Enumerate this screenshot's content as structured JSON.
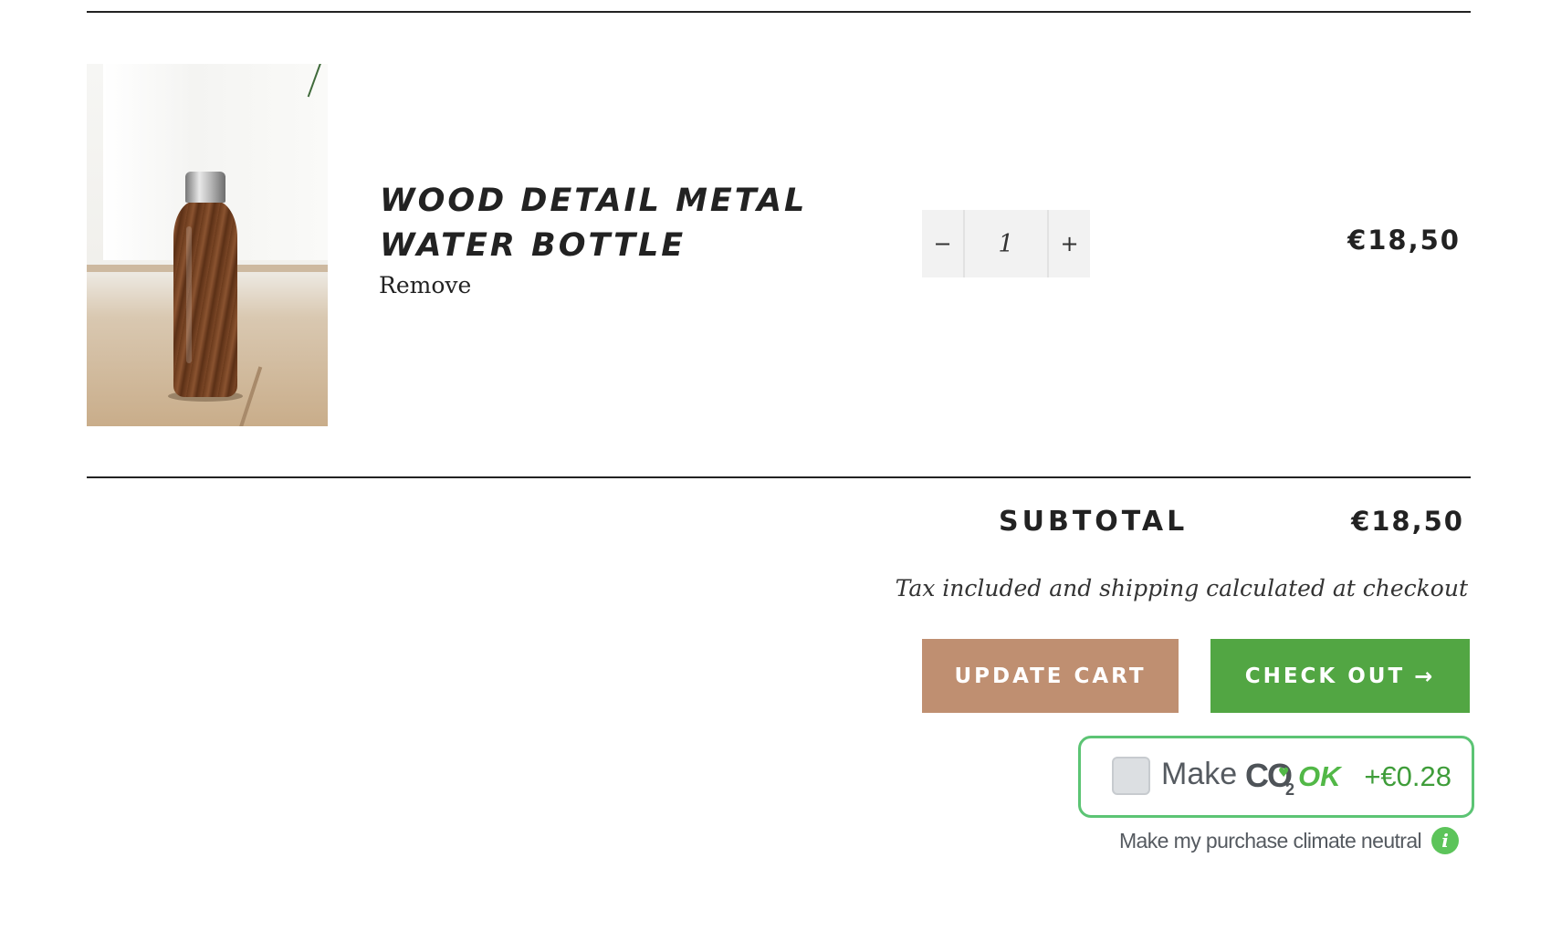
{
  "cart_item": {
    "title": "WOOD DETAIL METAL WATER BOTTLE",
    "remove_label": "Remove",
    "quantity": "1",
    "decrease_label": "−",
    "increase_label": "+",
    "line_price": "€18,50",
    "image_icon": "water-bottle-photo"
  },
  "totals": {
    "subtotal_label": "SUBTOTAL",
    "subtotal_value": "€18,50",
    "tax_note": "Tax included and shipping calculated at checkout"
  },
  "actions": {
    "update_cart_label": "UPDATE CART",
    "checkout_label": "CHECK OUT",
    "checkout_arrow": "→"
  },
  "co2ok": {
    "make_label": "Make",
    "logo_text_co": "CO",
    "logo_text_two": "2",
    "logo_text_ok": "OK",
    "price": "+€0.28",
    "caption": "Make my purchase climate neutral",
    "info_icon_glyph": "i",
    "checked": false,
    "accent_color": "#5cc474"
  },
  "colors": {
    "update_button": "#bf8f71",
    "checkout_button": "#52a643",
    "text": "#222222"
  }
}
